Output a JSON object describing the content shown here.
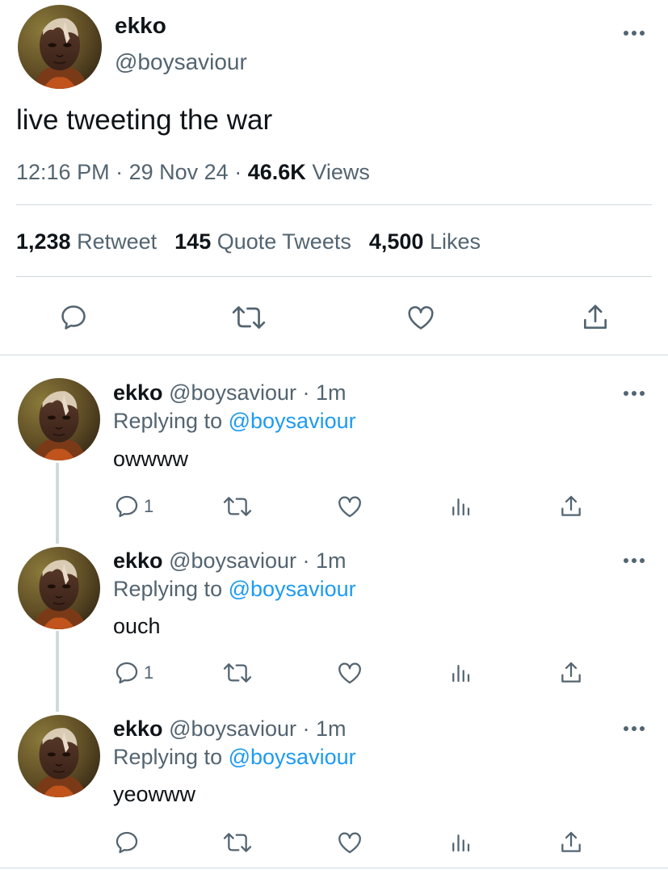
{
  "main_tweet": {
    "name": "ekko",
    "handle": "@boysaviour",
    "text": "live tweeting the war",
    "time": "12:16 PM",
    "date": "29 Nov 24",
    "views_count": "46.6K",
    "views_label": "Views",
    "separator": "·",
    "stats": {
      "retweets_count": "1,238",
      "retweets_label": "Retweet",
      "quotes_count": "145",
      "quotes_label": "Quote Tweets",
      "likes_count": "4,500",
      "likes_label": "Likes"
    }
  },
  "replies": [
    {
      "name": "ekko",
      "handle_time": "@boysaviour · 1m",
      "replying_prefix": "Replying to",
      "replying_to": "@boysaviour",
      "text": "owwww",
      "reply_count": "1"
    },
    {
      "name": "ekko",
      "handle_time": "@boysaviour · 1m",
      "replying_prefix": "Replying to",
      "replying_to": "@boysaviour",
      "text": "ouch",
      "reply_count": "1"
    },
    {
      "name": "ekko",
      "handle_time": "@boysaviour · 1m",
      "replying_prefix": "Replying to",
      "replying_to": "@boysaviour",
      "text": "yeowww",
      "reply_count": ""
    }
  ],
  "icons": {
    "reply": "comment-icon",
    "retweet": "retweet-icon",
    "like": "heart-icon",
    "analytics": "analytics-icon",
    "share": "share-icon",
    "more": "more-icon"
  },
  "colors": {
    "link": "#1d9bf0",
    "secondary_text": "#536471",
    "primary_text": "#0f1419",
    "divider": "#cfd9de"
  }
}
